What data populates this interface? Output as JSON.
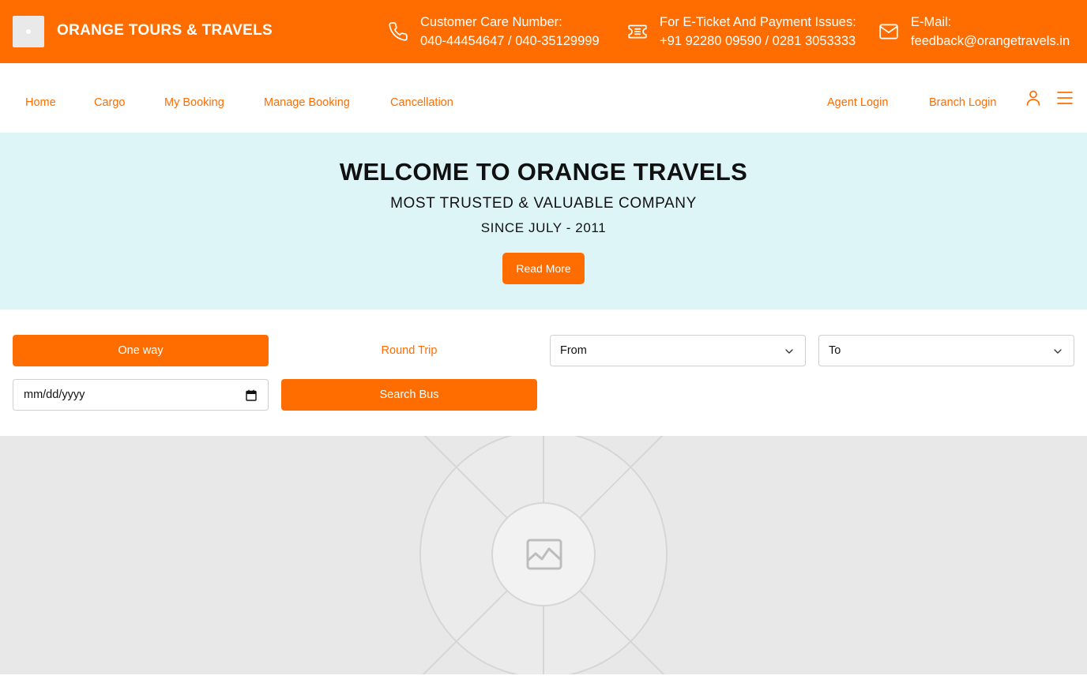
{
  "brand": {
    "name": "ORANGE TOURS & TRAVELS",
    "logo_icon": "logo-placeholder-icon"
  },
  "contacts": [
    {
      "icon": "phone-icon",
      "label": "Customer Care Number:",
      "value": "040-44454647 / 040-35129999"
    },
    {
      "icon": "ticket-icon",
      "label": "For E-Ticket And Payment Issues:",
      "value": "+91 92280 09590 / 0281 3053333"
    },
    {
      "icon": "mail-icon",
      "label": "E-Mail:",
      "value": "feedback@orangetravels.in"
    }
  ],
  "nav": {
    "left": [
      "Home",
      "Cargo",
      "My Booking",
      "Manage Booking",
      "Cancellation"
    ],
    "right": [
      "Agent Login",
      "Branch Login"
    ],
    "icons": [
      "user-icon",
      "menu-icon"
    ]
  },
  "hero": {
    "title": "WELCOME TO ORANGE TRAVELS",
    "subtitle": "MOST TRUSTED & VALUABLE COMPANY",
    "since": "SINCE JULY - 2011",
    "cta": "Read More"
  },
  "search": {
    "one_way": "One way",
    "round_trip": "Round Trip",
    "from": "From",
    "to": "To",
    "date_placeholder": "mm/dd/yyyy",
    "submit": "Search Bus"
  },
  "colors": {
    "accent": "#ff6d00",
    "hero_bg": "#def5f7",
    "placeholder_bg": "#e8e8e8"
  }
}
